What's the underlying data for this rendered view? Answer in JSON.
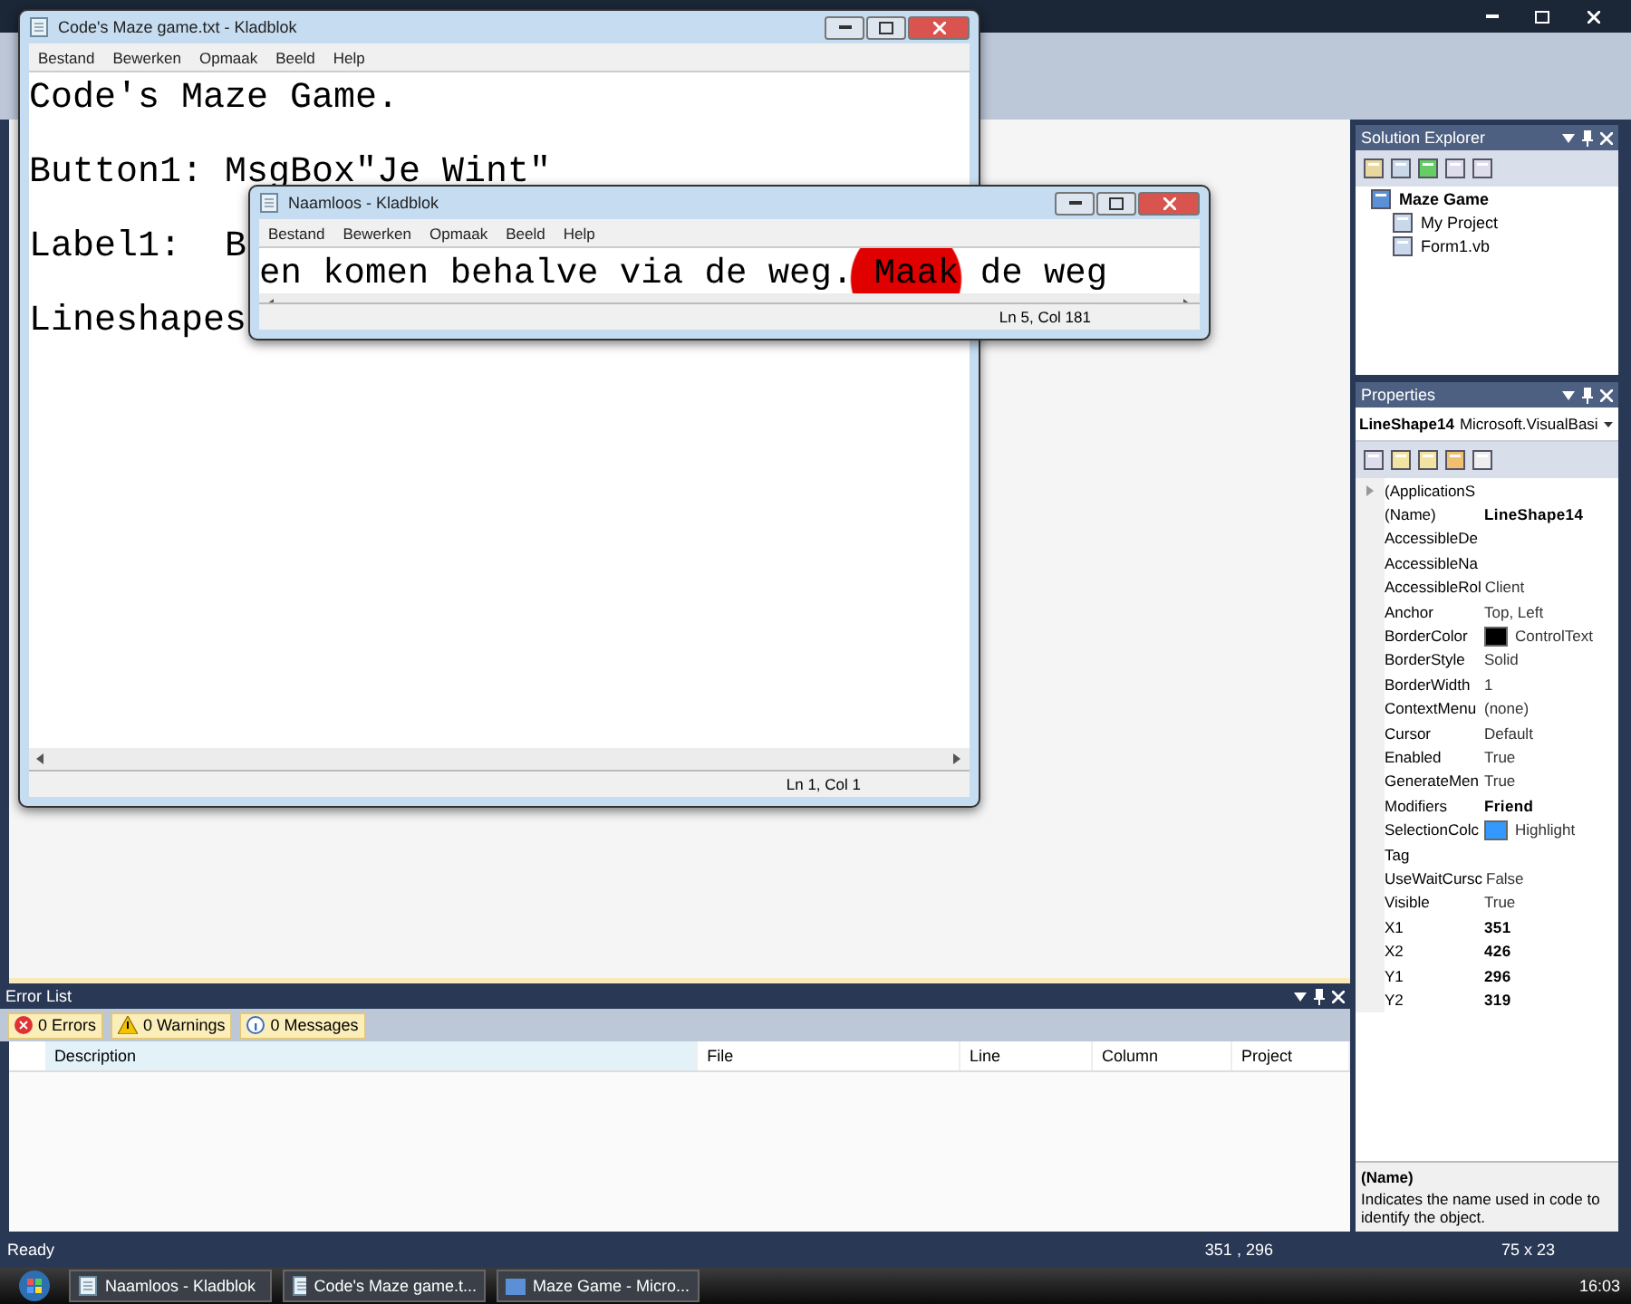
{
  "notepad_back": {
    "title": "Code's Maze game.txt - Kladblok",
    "menu": [
      "Bestand",
      "Bewerken",
      "Opmaak",
      "Beeld",
      "Help"
    ],
    "lines": [
      "Code's Maze Game.",
      "Button1: MsgBox\"Je Wint\"",
      "Label1:  B",
      "Lineshapes"
    ],
    "status": "Ln 1, Col 1"
  },
  "notepad_front": {
    "title": "Naamloos - Kladblok",
    "menu": [
      "Bestand",
      "Bewerken",
      "Opmaak",
      "Beeld",
      "Help"
    ],
    "text": "en komen behalve via de weg. Maak de weg",
    "status": "Ln 5, Col 181"
  },
  "solution_explorer": {
    "title": "Solution Explorer",
    "tree": [
      {
        "label": "Maze Game",
        "children": [
          {
            "label": "My Project"
          },
          {
            "label": "Form1.vb"
          }
        ]
      }
    ]
  },
  "properties": {
    "title": "Properties",
    "object": "LineShape14",
    "object_type": "Microsoft.VisualBasi",
    "rows": [
      {
        "name": "(ApplicationS",
        "expandable": true
      },
      {
        "name": "(Name)",
        "value": "LineShape14",
        "bold": true,
        "expandable": false
      },
      {
        "name": "AccessibleDe",
        "expandable": false
      },
      {
        "name": "AccessibleNa",
        "expandable": false
      },
      {
        "name": "AccessibleRol",
        "value": "Client",
        "bold": false,
        "expandable": false
      },
      {
        "name": "Anchor",
        "value": "Top, Left",
        "bold": false,
        "expandable": false
      },
      {
        "name": "BorderColor",
        "value": "ControlText",
        "color": "#000000",
        "bold": false,
        "expandable": false
      },
      {
        "name": "BorderStyle",
        "value": "Solid",
        "bold": false,
        "expandable": false
      },
      {
        "name": "BorderWidth",
        "value": "1",
        "bold": false,
        "expandable": false
      },
      {
        "name": "ContextMenu",
        "value": "(none)",
        "bold": false,
        "expandable": false
      },
      {
        "name": "Cursor",
        "value": "Default",
        "bold": false,
        "expandable": false
      },
      {
        "name": "Enabled",
        "value": "True",
        "bold": false,
        "expandable": false
      },
      {
        "name": "GenerateMen",
        "value": "True",
        "bold": false,
        "expandable": false
      },
      {
        "name": "Modifiers",
        "value": "Friend",
        "bold": true,
        "expandable": false
      },
      {
        "name": "SelectionColc",
        "value": "Highlight",
        "color": "#3399ff",
        "bold": false,
        "expandable": false
      },
      {
        "name": "Tag",
        "expandable": false
      },
      {
        "name": "UseWaitCursc",
        "value": "False",
        "bold": false,
        "expandable": false
      },
      {
        "name": "Visible",
        "value": "True",
        "bold": false,
        "expandable": false
      },
      {
        "name": "X1",
        "value": "351",
        "bold": true,
        "expandable": false
      },
      {
        "name": "X2",
        "value": "426",
        "bold": true,
        "expandable": false
      },
      {
        "name": "Y1",
        "value": "296",
        "bold": true,
        "expandable": false
      },
      {
        "name": "Y2",
        "value": "319",
        "bold": true,
        "expandable": false
      }
    ],
    "description_title": "(Name)",
    "description": "Indicates the name used in code to identify the object."
  },
  "error_list": {
    "title": "Error List",
    "filters": [
      {
        "kind": "error",
        "label": "0 Errors"
      },
      {
        "kind": "warning",
        "label": "0 Warnings"
      },
      {
        "kind": "info",
        "label": "0 Messages"
      }
    ],
    "columns": [
      "Description",
      "File",
      "Line",
      "Column",
      "Project"
    ]
  },
  "status_bar": {
    "text": "Ready",
    "position": "351 , 296",
    "size": "75 x 23"
  },
  "taskbar": {
    "buttons": [
      {
        "label": "Naamloos - Kladblok",
        "kind": "notepad"
      },
      {
        "label": "Code's Maze game.t...",
        "kind": "notepad"
      },
      {
        "label": "Maze Game - Micro...",
        "kind": "vs"
      }
    ],
    "clock": "16:03"
  }
}
